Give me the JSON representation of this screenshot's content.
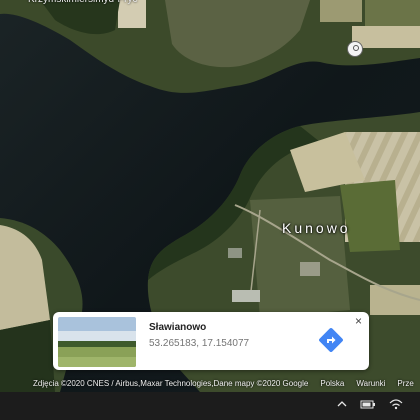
{
  "map": {
    "top_label": "Krzymskimiersimyd-Pryc",
    "place_label": "Kunowo",
    "pin_icon": "location-pin-icon"
  },
  "place_card": {
    "name": "Sławianowo",
    "coordinates": "53.265183, 17.154077",
    "close_label": "×",
    "directions_icon": "directions-icon",
    "accent_color": "#4285f4"
  },
  "attribution": {
    "imagery": "Zdjęcia ©2020 CNES / Airbus,Maxar Technologies,Dane mapy ©2020 Google",
    "country": "Polska",
    "terms": "Warunki",
    "privacy": "Prze"
  },
  "taskbar": {
    "icons": [
      "chevron-up-icon",
      "battery-icon",
      "wifi-icon"
    ]
  }
}
